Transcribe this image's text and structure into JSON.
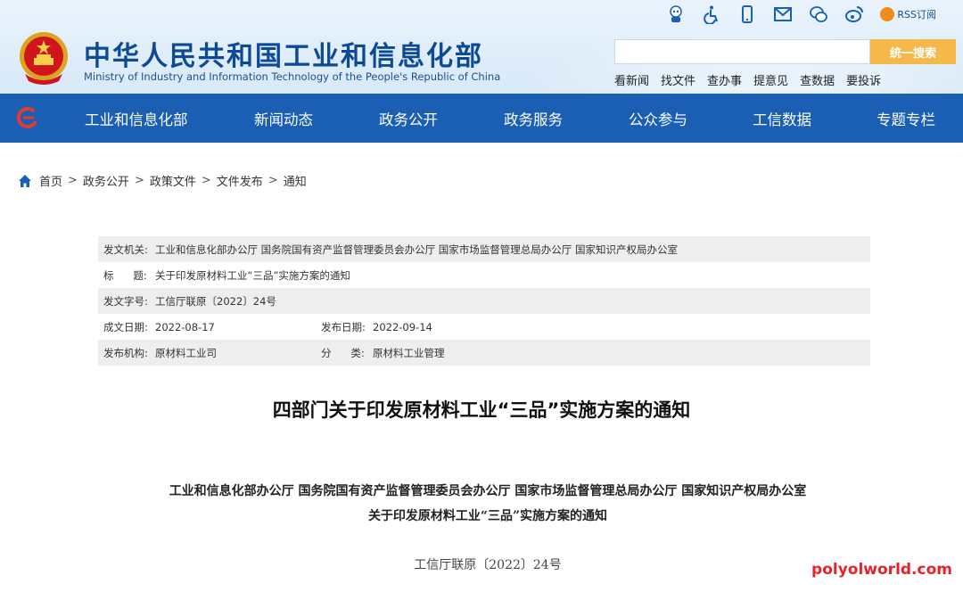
{
  "header": {
    "title_cn": "中华人民共和国工业和信息化部",
    "title_en": "Ministry of Industry and Information Technology of the People's Republic of China",
    "rss_label": "RSS订阅",
    "top_icons": [
      "robot-icon",
      "accessibility-icon",
      "mobile-icon",
      "mail-icon",
      "wechat-icon",
      "weibo-icon"
    ],
    "search": {
      "placeholder": "",
      "button_label": "统一搜索"
    },
    "quick_links": [
      "看新闻",
      "找文件",
      "查办事",
      "提意见",
      "查数据",
      "要投诉"
    ]
  },
  "nav": {
    "items": [
      "工业和信息化部",
      "新闻动态",
      "政务公开",
      "政务服务",
      "公众参与",
      "工信数据",
      "专题专栏"
    ]
  },
  "breadcrumb": [
    "首页",
    "政务公开",
    "政策文件",
    "文件发布",
    "通知"
  ],
  "meta": {
    "issuer_label": "发文机关:",
    "issuer_value": "工业和信息化部办公厅 国务院国有资产监督管理委员会办公厅 国家市场监督管理总局办公厅 国家知识产权局办公室",
    "title_label": "标      题:",
    "title_value": "关于印发原材料工业“三品”实施方案的通知",
    "docno_label": "发文字号:",
    "docno_value": "工信厅联原〔2022〕24号",
    "written_label": "成文日期:",
    "written_value": "2022-08-17",
    "published_label": "发布日期:",
    "published_value": "2022-09-14",
    "agency_label": "发布机构:",
    "agency_value": "原材料工业司",
    "category_label": "分      类:",
    "category_value": "原材料工业管理"
  },
  "article": {
    "title": "四部门关于印发原材料工业“三品”实施方案的通知",
    "issuers": "工业和信息化部办公厅 国务院国有资产监督管理委员会办公厅 国家市场监督管理总局办公厅 国家知识产权局办公室",
    "subtitle": "关于印发原材料工业“三品”实施方案的通知",
    "docno": "工信厅联原〔2022〕24号"
  },
  "watermark": "polyolworld.com",
  "colors": {
    "nav_bg": "#1a5fb4",
    "search_btn": "#f4b94a",
    "title_blue": "#0d4a95",
    "watermark": "#e5222a"
  }
}
